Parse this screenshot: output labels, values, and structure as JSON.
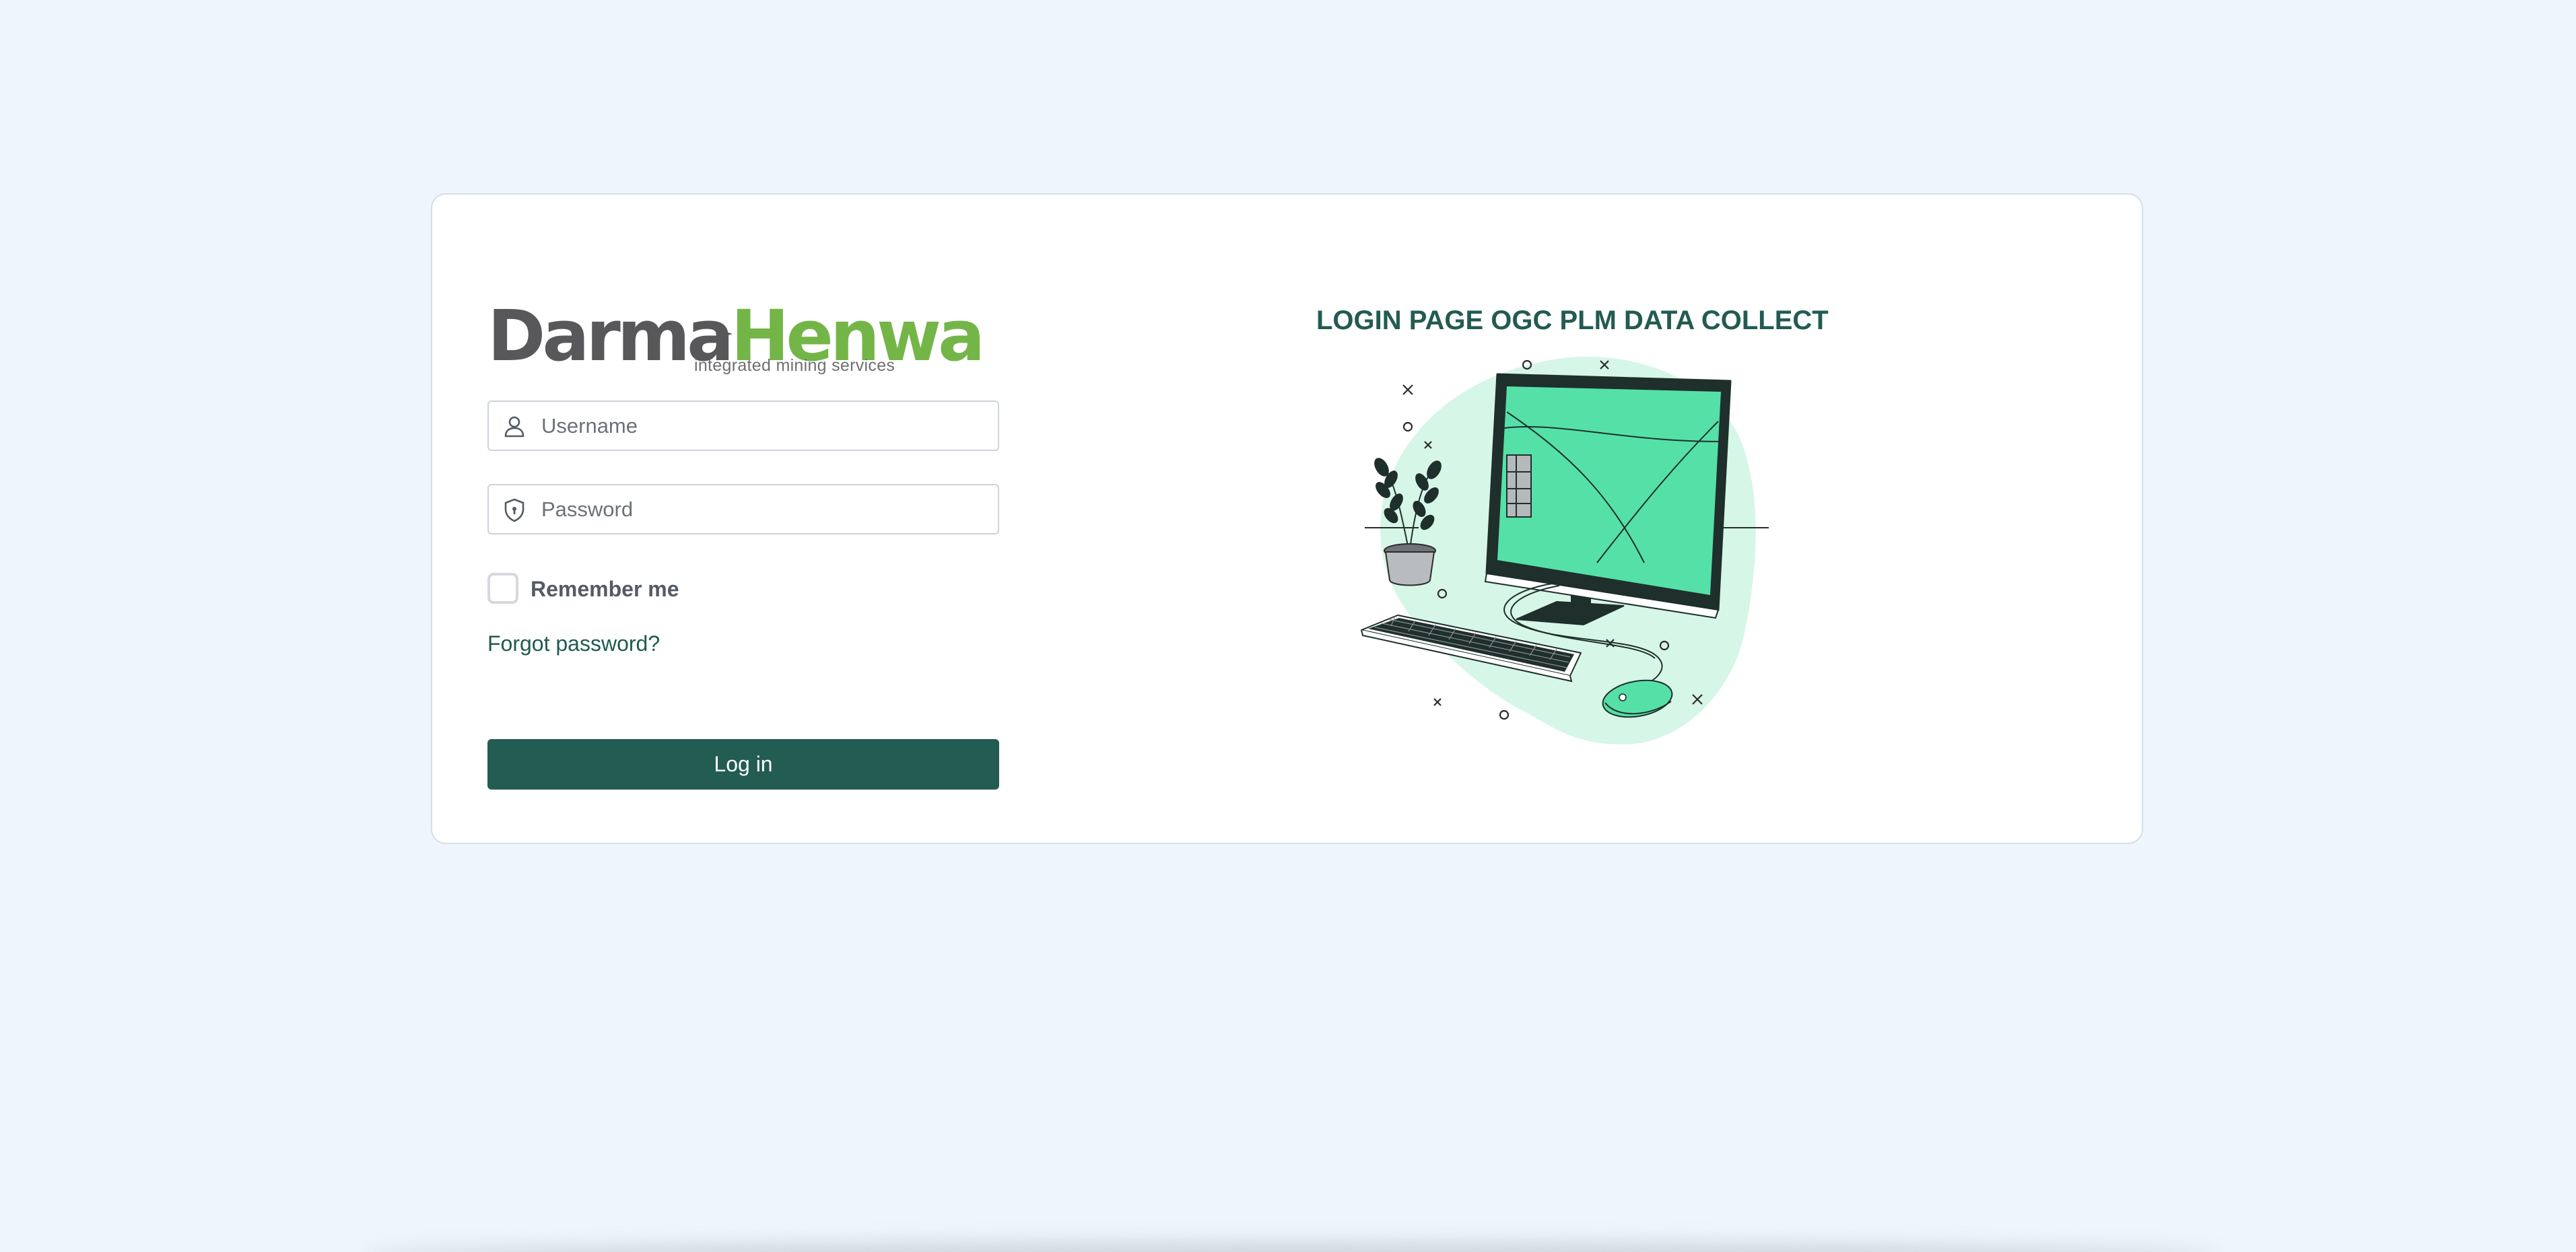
{
  "brand": {
    "logo_part1": "Darma",
    "logo_part2": "Henwa",
    "tagline": "integrated mining services"
  },
  "login_form": {
    "username_placeholder": "Username",
    "password_placeholder": "Password",
    "remember_label": "Remember me",
    "remember_checked": false,
    "forgot_link": "Forgot password?",
    "submit_label": "Log in"
  },
  "right_panel": {
    "title": "LOGIN PAGE OGC PLM DATA COLLECT",
    "illustration": "desktop-computer-illustration"
  },
  "icons": {
    "username": "user-icon",
    "password": "shield-lock-icon"
  },
  "colors": {
    "background": "#eef5fd",
    "primary": "#225c53",
    "brand_gray": "#58585b",
    "brand_green": "#74b548",
    "illustration_accent": "#55e0a8"
  }
}
